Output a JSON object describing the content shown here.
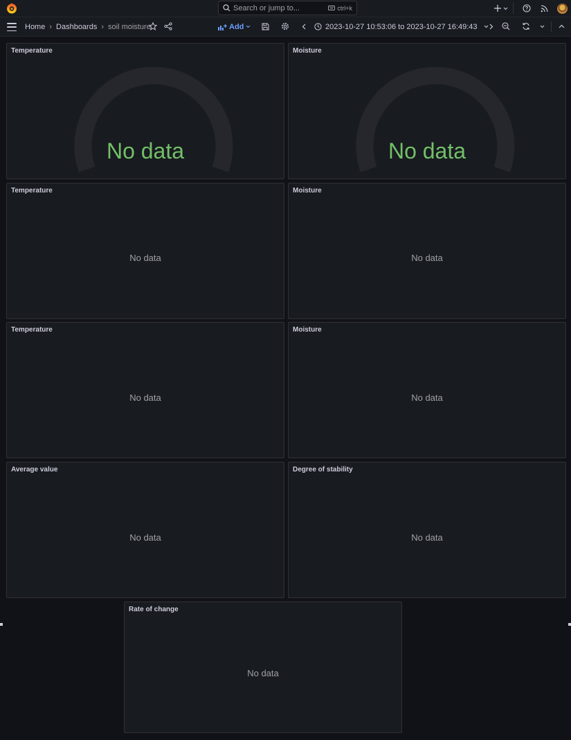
{
  "topbar": {
    "search_placeholder": "Search or jump to...",
    "search_shortcut": "ctrl+k",
    "icons": [
      "grafana-logo-icon",
      "search-icon",
      "keyboard-icon",
      "plus-icon",
      "chevron-down-icon",
      "help-icon",
      "news-feed-icon",
      "user-avatar"
    ]
  },
  "navbar": {
    "breadcrumbs": [
      "Home",
      "Dashboards",
      "soil moisture"
    ],
    "add_label": "Add",
    "time_from": "2023-10-27 10:53:06",
    "time_join": "to",
    "time_to": "2023-10-27 16:49:43",
    "accent_color": "#6e9fff"
  },
  "panels": [
    {
      "title": "Temperature",
      "type": "gauge",
      "message": "No data"
    },
    {
      "title": "Moisture",
      "type": "gauge",
      "message": "No data"
    },
    {
      "title": "Temperature",
      "type": "timeseries",
      "message": "No data"
    },
    {
      "title": "Moisture",
      "type": "timeseries",
      "message": "No data"
    },
    {
      "title": "Temperature",
      "type": "timeseries",
      "message": "No data"
    },
    {
      "title": "Moisture",
      "type": "timeseries",
      "message": "No data"
    },
    {
      "title": "Average value",
      "type": "stat",
      "message": "No data"
    },
    {
      "title": "Degree of stability",
      "type": "stat",
      "message": "No data"
    },
    {
      "title": "Rate of change",
      "type": "stat",
      "message": "No data"
    }
  ],
  "colors": {
    "gauge_text": "#73bf69",
    "background": "#111217",
    "panel": "#181b1f"
  }
}
